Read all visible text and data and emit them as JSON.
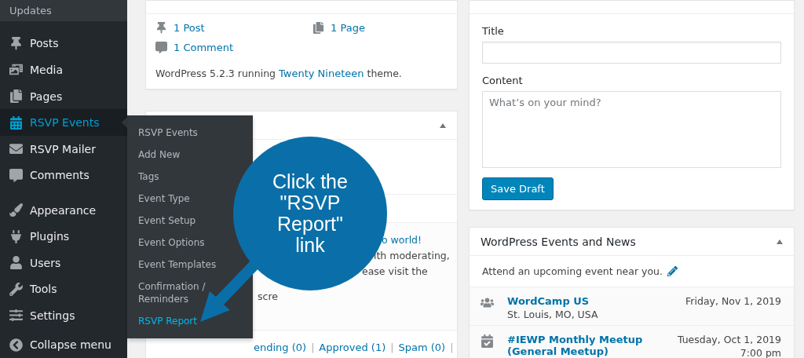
{
  "sidebar": {
    "top_item": "Updates",
    "groups": [
      [
        {
          "label": "Posts",
          "selected": false
        },
        {
          "label": "Media",
          "selected": false
        },
        {
          "label": "Pages",
          "selected": false
        },
        {
          "label": "RSVP Events",
          "selected": true
        },
        {
          "label": "RSVP Mailer",
          "selected": false
        },
        {
          "label": "Comments",
          "selected": false
        }
      ],
      [
        {
          "label": "Appearance",
          "selected": false
        },
        {
          "label": "Plugins",
          "selected": false
        },
        {
          "label": "Users",
          "selected": false
        },
        {
          "label": "Tools",
          "selected": false
        },
        {
          "label": "Settings",
          "selected": false
        }
      ]
    ],
    "collapse": "Collapse menu"
  },
  "flyout": {
    "items": [
      {
        "label": "RSVP Events",
        "selected": false
      },
      {
        "label": "Add New",
        "selected": false
      },
      {
        "label": "Tags",
        "selected": false
      },
      {
        "label": "Event Type",
        "selected": false
      },
      {
        "label": "Event Setup",
        "selected": false
      },
      {
        "label": "Event Options",
        "selected": false
      },
      {
        "label": "Event Templates",
        "selected": false
      },
      {
        "label": "Confirmation / Reminders",
        "selected": false
      },
      {
        "label": "RSVP Report",
        "selected": true
      }
    ]
  },
  "at_a_glance": {
    "items": [
      "1 Post",
      "1 Page",
      "1 Comment"
    ],
    "version_text": "WordPress 5.2.3 running",
    "theme_link": "Twenty Nineteen",
    "version_suffix": "theme."
  },
  "activity": {
    "comment_fragments": [
      "o world!",
      "ith moderating,",
      "ease visit the",
      "scre"
    ],
    "filters": [
      "ending (0)",
      "Approved (1)",
      "Spam (0)"
    ],
    "separator": "|"
  },
  "quick_draft": {
    "title_label": "Title",
    "content_label": "Content",
    "content_placeholder": "What’s on your mind?",
    "button": "Save Draft"
  },
  "events": {
    "title": "WordPress Events and News",
    "intro": "Attend an upcoming event near you.",
    "items": [
      {
        "name": "WordCamp US",
        "location": "St. Louis, MO, USA",
        "date": "Friday, Nov 1, 2019"
      },
      {
        "name": "#IEWP Monthly Meetup (General Meetup)",
        "date": "Tuesday, Oct 1, 2019",
        "time": "7:00 pm"
      }
    ]
  },
  "callout": {
    "text": "Click the \"RSVP Report\" link"
  }
}
